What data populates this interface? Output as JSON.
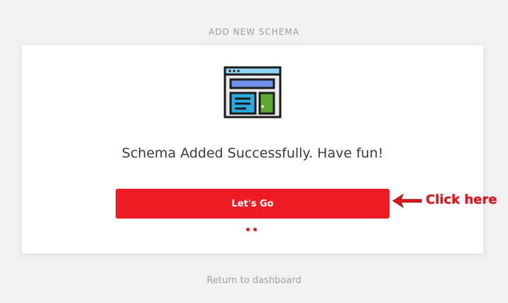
{
  "header": {
    "title": "ADD NEW SCHEMA"
  },
  "card": {
    "message": "Schema Added Successfully. Have fun!",
    "cta_label": "Let's Go",
    "illustration_icon": "webpage-layout-icon"
  },
  "annotation": {
    "text": "Click here",
    "arrow_icon": "left-arrow-icon",
    "color": "#e3161e"
  },
  "footer": {
    "link_label": "Return to dashboard"
  },
  "colors": {
    "page_background": "#f1f1f1",
    "card_background": "#ffffff",
    "accent_red": "#ef1c26",
    "muted_text": "#9a9a9a"
  }
}
